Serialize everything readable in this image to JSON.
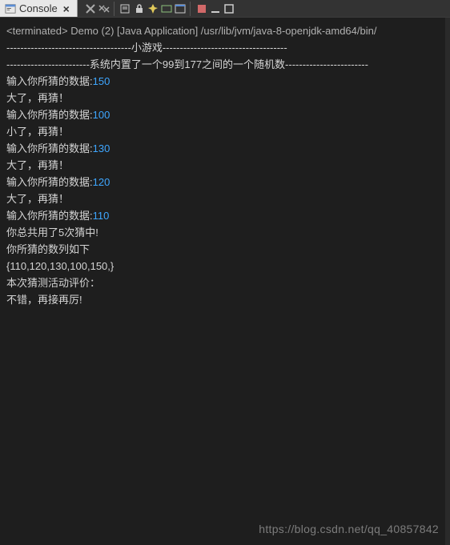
{
  "tab": {
    "title": "Console"
  },
  "run_info": {
    "status": "<terminated>",
    "label": "Demo (2) [Java Application] /usr/lib/jvm/java-8-openjdk-amd64/bin/"
  },
  "output": {
    "header1": "------------------------------------小游戏------------------------------------",
    "header2": "------------------------系统内置了一个99到177之间的一个随机数------------------------",
    "prompt": "输入你所猜的数据:",
    "attempts": [
      {
        "guess": "150",
        "feedback": "大了，再猜！"
      },
      {
        "guess": "100",
        "feedback": "小了，再猜！"
      },
      {
        "guess": "130",
        "feedback": "大了，再猜！"
      },
      {
        "guess": "120",
        "feedback": "大了，再猜！"
      },
      {
        "guess": "110",
        "feedback": ""
      }
    ],
    "result_count": "你总共用了5次猜中!",
    "result_list_label": "你所猜的数列如下",
    "result_list": "{110,120,130,100,150,}",
    "blank": "",
    "eval_label": "本次猜测活动评价：",
    "eval_result": "不错，再接再厉!"
  },
  "watermark": "https://blog.csdn.net/qq_40857842"
}
